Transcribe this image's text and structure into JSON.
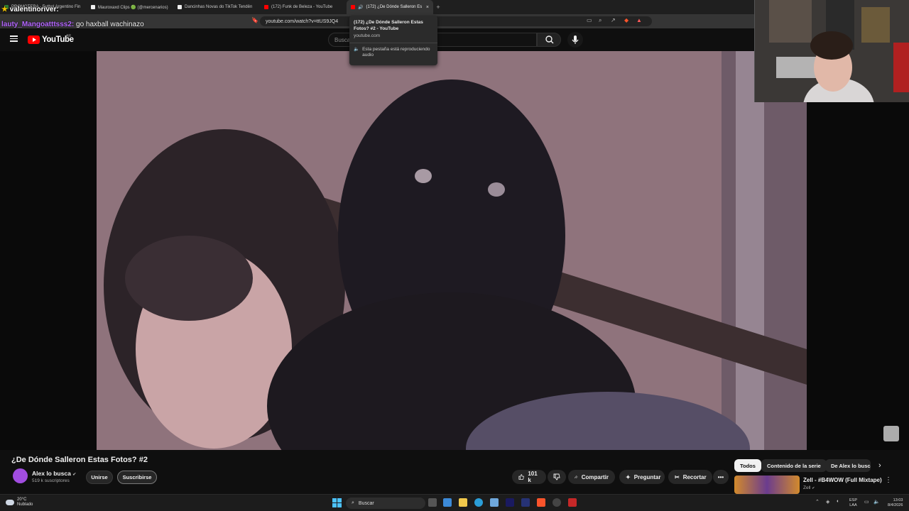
{
  "browser": {
    "tabs": [
      {
        "title": "PROMOTERA - Futbol Argentino Fin",
        "color": "#2e7d32"
      },
      {
        "title": "Mauroxaxd Clips 🟢 (@mercenarios)",
        "color": "#eeeeee"
      },
      {
        "title": "Dancinhas Novas do TikTok Tendên",
        "color": "#eeeeee"
      },
      {
        "title": "(172) Funk de Beleza - YouTube",
        "color": "#ff0000"
      },
      {
        "title": "(172) ¿De Dónde Salleron Es",
        "color": "#ff0000",
        "active": true
      }
    ],
    "new_tab": "+",
    "close_glyph": "×",
    "url": "youtube.com/watch?v=ttUS9JQ4",
    "hover_card": {
      "title": "(172) ¿De Dónde Salleron Estas Fotos? #2 - YouTube",
      "domain": "youtube.com",
      "audio_note": "Esta pestaña está reproduciendo audio"
    }
  },
  "stream_chat": {
    "line1_user": "valentinoriver:",
    "line2_user": "lauty_Mangoatttsss2:",
    "line2_message": " go haxball wachinazo"
  },
  "youtube": {
    "logo_text": "YouTube",
    "country": "AR",
    "search_placeholder": "Buscar",
    "video": {
      "title": "¿De Dónde Salleron Estas Fotos? #2",
      "channel": "Alex lo busca",
      "verified": "✔",
      "subscribers": "519 k suscriptores",
      "join_label": "Unirse",
      "subscribe_label": "Suscribirse",
      "likes": "101 k",
      "share_label": "Compartir",
      "ask_label": "Preguntar",
      "clip_label": "Recortar",
      "more_label": "•••"
    },
    "chips": [
      "Todos",
      "Contenido de la serie",
      "De Alex lo busca"
    ],
    "chips_next": "›",
    "recommended": {
      "title": "Zell - #B4WOW (Full Mixtape)",
      "channel": "Zell",
      "menu": "⋮"
    }
  },
  "taskbar": {
    "weather_temp": "20°C",
    "weather_desc": "Nublado",
    "search_label": "Buscar",
    "lang_top": "ESP",
    "lang_bottom": "LAA",
    "time": "13:03",
    "date": "8/4/2026",
    "tray_arrow": "⌃"
  },
  "colors": {
    "youtube_red": "#ff0000",
    "background": "#0f0f0f",
    "chip_active": "#f1f1f1",
    "chat_username_purple": "#b466ff"
  }
}
